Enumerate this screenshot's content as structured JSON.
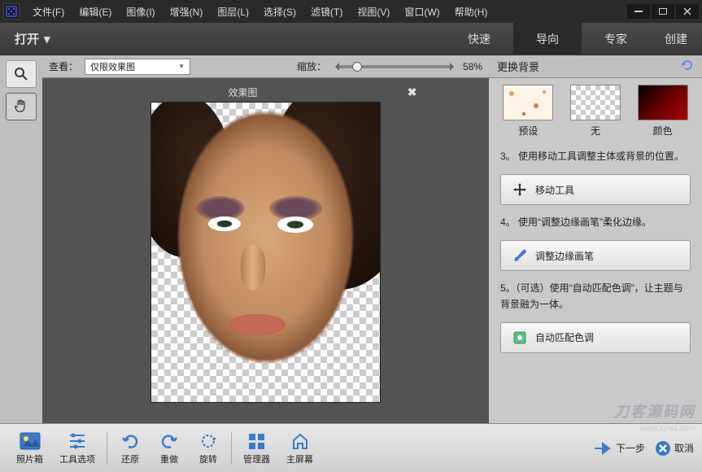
{
  "menubar": {
    "items": [
      "文件(F)",
      "编辑(E)",
      "图像(I)",
      "增强(N)",
      "图层(L)",
      "选择(S)",
      "滤镜(T)",
      "视图(V)",
      "窗口(W)",
      "帮助(H)"
    ]
  },
  "toolbar": {
    "open": "打开"
  },
  "modes": {
    "quick": "快速",
    "guided": "导向",
    "expert": "专家",
    "create": "创建"
  },
  "options": {
    "view_label": "查看：",
    "view_value": "仅限效果图",
    "zoom_label": "缩放：",
    "zoom_value": "58%"
  },
  "canvas": {
    "label": "效果图"
  },
  "panel": {
    "title": "更换背景",
    "bg": {
      "preset": "预设",
      "none": "无",
      "color": "颜色"
    },
    "step3": "3。 使用移动工具调整主体或背景的位置。",
    "move_btn": "移动工具",
    "step4": "4。 使用“调整边缘画笔”柔化边缘。",
    "brush_btn": "调整边缘画笔",
    "step5": "5。（可选）使用“自动匹配色调”，让主题与背景融为一体。",
    "tone_btn": "自动匹配色调"
  },
  "bottom": {
    "photobin": "照片箱",
    "tooloptions": "工具选项",
    "undo": "还原",
    "redo": "重做",
    "rotate": "旋转",
    "organizer": "管理器",
    "home": "主屏幕",
    "next": "下一步",
    "cancel": "取消"
  },
  "watermark": {
    "main": "刀客源码网",
    "sub": "www.zyw1.com"
  }
}
